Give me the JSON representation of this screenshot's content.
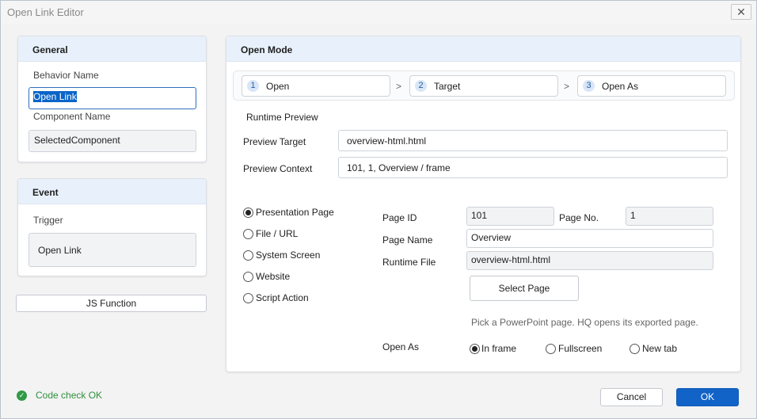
{
  "window": {
    "title": "Open Link Editor",
    "close_glyph": "✕"
  },
  "general": {
    "header": "General",
    "behavior_name_label": "Behavior Name",
    "behavior_name_value": "Open Link",
    "component_name_label": "Component Name",
    "component_name_value": "SelectedComponent"
  },
  "event": {
    "header": "Event",
    "trigger_label": "Trigger",
    "trigger_value": "Open Link"
  },
  "js_function_label": "JS Function",
  "open_mode": {
    "header": "Open Mode",
    "steps": [
      {
        "num": "1",
        "label": "Open"
      },
      {
        "num": "2",
        "label": "Target"
      },
      {
        "num": "3",
        "label": "Open As"
      }
    ],
    "step_separator": ">",
    "runtime_preview_label": "Runtime Preview",
    "preview_target_label": "Preview Target",
    "preview_target_value": "overview-html.html",
    "preview_context_label": "Preview Context",
    "preview_context_value": "101, 1, Overview / frame",
    "options": [
      {
        "label": "Presentation Page",
        "selected": true
      },
      {
        "label": "File / URL",
        "selected": false
      },
      {
        "label": "System Screen",
        "selected": false
      },
      {
        "label": "Website",
        "selected": false
      },
      {
        "label": "Script Action",
        "selected": false
      }
    ],
    "page_id_label": "Page ID",
    "page_id_value": "101",
    "page_no_label": "Page No.",
    "page_no_value": "1",
    "page_name_label": "Page Name",
    "page_name_value": "Overview",
    "runtime_file_label": "Runtime File",
    "runtime_file_value": "overview-html.html",
    "select_page_label": "Select Page",
    "hint": "Pick a PowerPoint page. HQ opens its exported page.",
    "open_as_label": "Open As",
    "open_as_options": [
      {
        "label": "In frame",
        "selected": true
      },
      {
        "label": "Fullscreen",
        "selected": false
      },
      {
        "label": "New tab",
        "selected": false
      }
    ]
  },
  "footer": {
    "status_icon": "check-circle-icon",
    "status_text": "Code check OK",
    "status_color": "#2f8f3c",
    "cancel_label": "Cancel",
    "ok_label": "OK",
    "accent_color": "#1263c8"
  }
}
